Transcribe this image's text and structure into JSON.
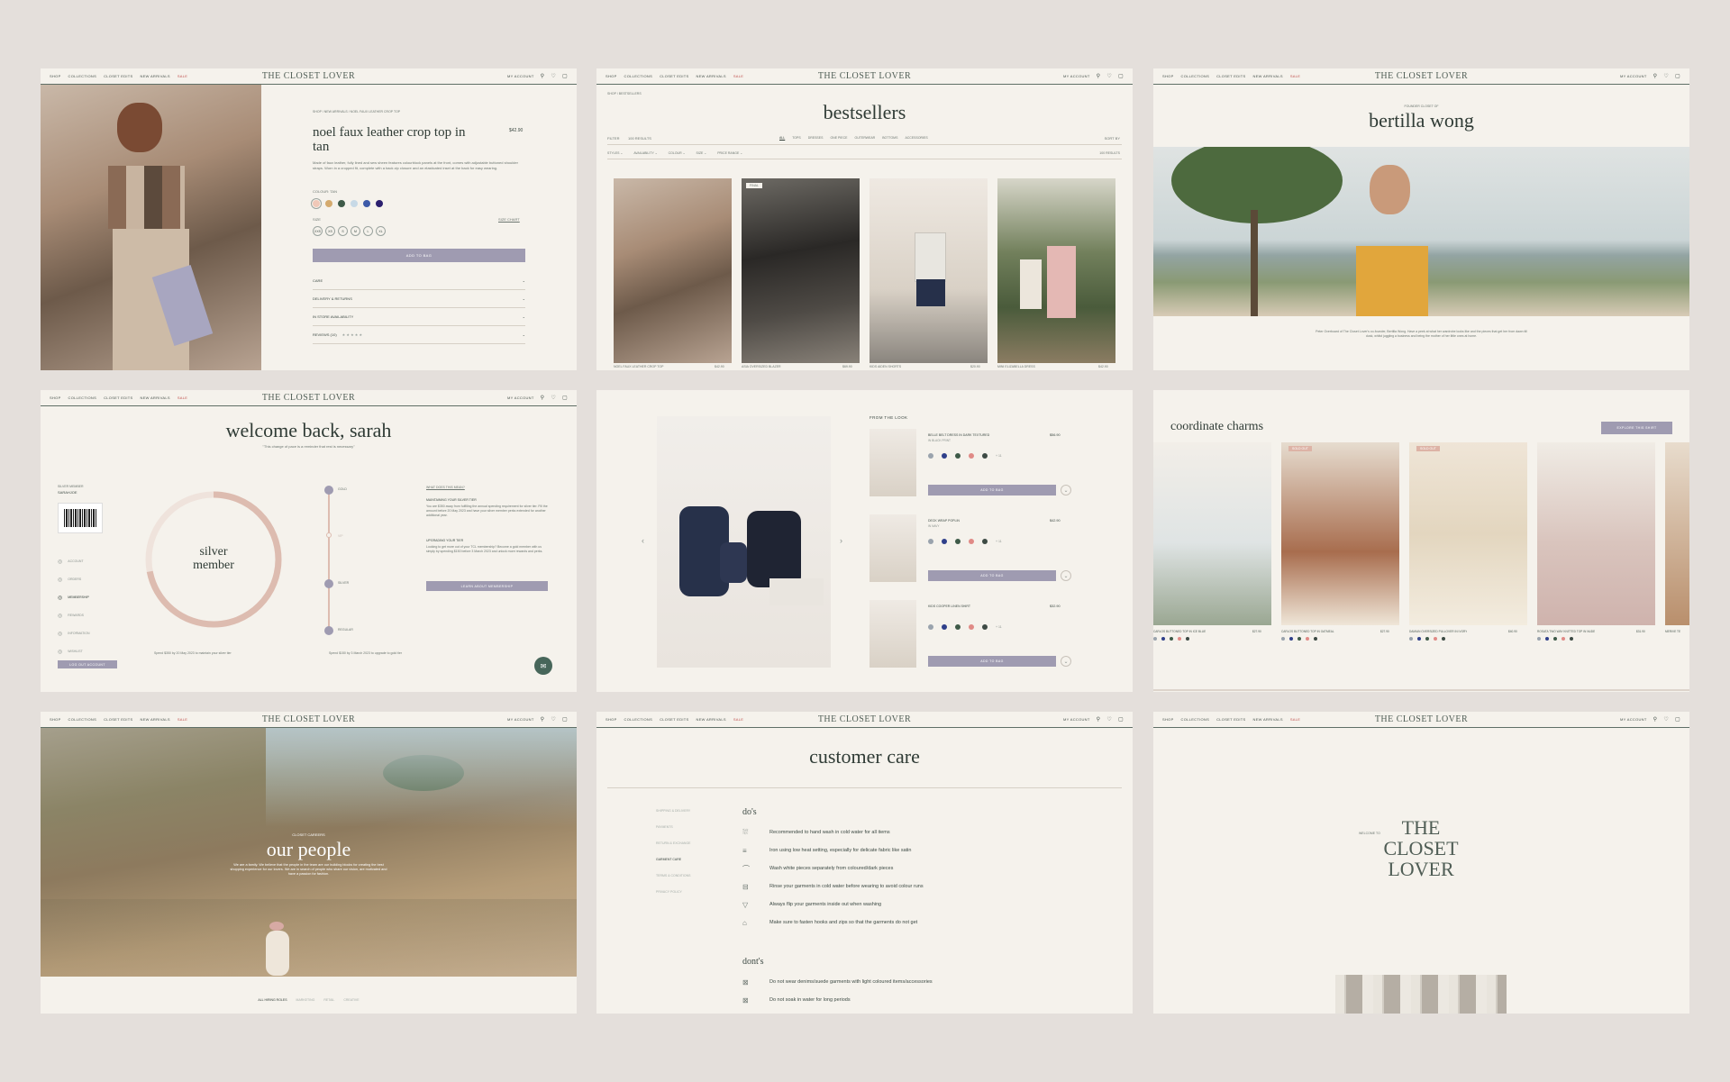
{
  "nav": {
    "links": [
      "SHOP",
      "COLLECTIONS",
      "CLOSET EDITS",
      "NEW ARRIVALS",
      "SALE"
    ],
    "logo": "THE CLOSET LOVER",
    "account": "MY ACCOUNT"
  },
  "product": {
    "breadcrumb": "SHOP / NEW ARRIVALS / NOEL FAUX LEATHER CROP TOP",
    "title": "noel faux leather crop top in tan",
    "price": "$42.90",
    "description": "Made of faux leather, fully lined and sew sheen features colourblock panels at the front, comes with adjustable buttoned shoulder straps. Worn in a cropped fit, complete with a back zip closure and an elasticated inset at the back for easy wearing.",
    "colour_label": "COLOUR: TAN",
    "swatches": [
      "#f0c8b8",
      "#d4aa6e",
      "#3e5a48",
      "#c7d9e6",
      "#3d5aa8",
      "#2b1f6e"
    ],
    "size_label": "SIZE",
    "size_chart": "SIZE CHART",
    "sizes": [
      "XXS",
      "XS",
      "S",
      "M",
      "L",
      "XL"
    ],
    "add_to_bag": "ADD TO BAG",
    "accordions": [
      "CARE",
      "DELIVERY & RETURNS",
      "IN STORE AVAILABILITY",
      "REVIEWS (10)"
    ],
    "stars": "★ ★ ★ ★ ★"
  },
  "bestsellers": {
    "breadcrumb": "SHOP / BESTSELLERS",
    "title": "bestsellers",
    "filters": [
      "FILTER",
      "100 RESULTS"
    ],
    "tabs": [
      "ALL",
      "TOPS",
      "DRESSES",
      "ONE PIECE",
      "OUTERWEAR",
      "BOTTOMS",
      "ACCESSORIES"
    ],
    "sort": "SORT BY",
    "subfilters": [
      "STYLES",
      "AVAILABILITY",
      "COLOUR",
      "SIZE",
      "PRICE RANGE"
    ],
    "results": "100 RESULTS",
    "badge": "FINAL",
    "items": [
      {
        "name": "NOEL FAUX LEATHER CROP TOP",
        "price": "$42.90"
      },
      {
        "name": "ASIA OVERSIZED BLAZER",
        "price": "$69.90"
      },
      {
        "name": "KIDS AIDEN SHORTS",
        "price": "$20.90"
      },
      {
        "name": "MINI ELIZABELLA DRESS",
        "price": "$42.90"
      }
    ]
  },
  "founder": {
    "eyebrow": "FOUNDER CLOSET OF",
    "title": "bertilla wong",
    "caption": "Peter Overboard of The Closet Lover's co-founder, Bertilla Wong. Have a peek at what her wardrobe looks like and the pieces that get her from dawn till dusk, whilst juggling a business and being the mother of her little ones at home."
  },
  "member": {
    "title": "welcome back, sarah",
    "subtitle": "\"This change of pace is a reminder that rest is necessary\"",
    "member_label": "SILVER MEMBER",
    "member_name": "SARAHJOE",
    "menu": [
      "ACCOUNT",
      "ORDERS",
      "MEMBERSHIP",
      "REWARDS",
      "INFORMATION",
      "WISHLIST"
    ],
    "logout": "LOG OUT ACCOUNT",
    "ring_label": "silver member",
    "ring_progress": 0.72,
    "tiers": [
      "GOLD",
      "VIP",
      "SILVER",
      "REGULAR"
    ],
    "note1": "Spend $350 by 20 May 2023 to maintain your silver tier",
    "note2": "Spend $150 by 3 March 2023 to upgrade to gold tier",
    "faq_q": "WHAT DOES THIS MEAN?",
    "faq_h1": "MAINTAINING YOUR SILVER TIER",
    "faq_p1": "You are $350 away from fulfilling the annual spending requirement for silver tier. Fill the amount before 20 May 2023 and have your silver member perks extended for another additional year.",
    "faq_h2": "UPGRADING YOUR TIER",
    "faq_p2": "Looking to get more out of your TCL membership? Become a gold member with us simply by spending $150 before 3 March 2023 and unlock more rewards and perks.",
    "learn": "LEARN ABOUT MEMBERSHIP"
  },
  "look": {
    "title": "FROM THE LOOK",
    "items": [
      {
        "name": "BELLE BELT DRESS IN DARK TEXTURED",
        "sub": "IN BLACK PRINT",
        "price": "$56.90"
      },
      {
        "name": "DECK WRAP POPLIN",
        "sub": "IN NAVY",
        "price": "$42.90"
      },
      {
        "name": "KIDS COOPER LINEN SHIRT",
        "sub": "",
        "price": "$32.90"
      }
    ],
    "add": "ADD TO BAG",
    "more": "+ 11"
  },
  "charms": {
    "title": "coordinate charms",
    "button": "EXPLORE THIS SHIRT",
    "sold_out": "SOLD OUT",
    "items": [
      {
        "name": "CARLOS BUTTONED TOP IN ICE BLUE",
        "price": "$27.90"
      },
      {
        "name": "CARLOS BUTTONED TOP IN OATMEAL",
        "price": "$27.90"
      },
      {
        "name": "DAMIAN OVERSIZED PULLOVER IN IVORY",
        "price": "$40.90"
      },
      {
        "name": "ROSATA TWO WAY KNITTED TOP IN NUDE",
        "price": "$31.90"
      },
      {
        "name": "MERIVE TE",
        "price": ""
      }
    ]
  },
  "careers": {
    "eyebrow": "CLOSET CAREERS",
    "title": "our people",
    "text": "We are a family. We believe that the people in the team are our building blocks for creating the best shopping experience for our lovers. We are in search of people who share our vision, are motivated and have a passion for fashion.",
    "tabs": [
      "ALL HIRING ROLES",
      "MARKETING",
      "RETAIL",
      "CREATIVE"
    ]
  },
  "care": {
    "title": "customer care",
    "menu": [
      "SHIPPING & DELIVERY",
      "PAYMENTS",
      "RETURN & EXCHANGE",
      "GARMENT CARE",
      "TERMS & CONDITIONS",
      "PRIVACY POLICY"
    ],
    "dos_title": "do's",
    "dos": [
      "Recommended to hand wash in cold water for all items",
      "Iron using low heat setting, especially for delicate fabric like satin",
      "Wash white pieces separately from coloured/dark pieces",
      "Rinse your garments in cold water before wearing to avoid colour runs",
      "Always flip your garments inside out when washing",
      "Make sure to fasten hooks and zips so that the garments do not get"
    ],
    "donts_title": "dont's",
    "donts": [
      "Do not wear denims/suede garments with light coloured items/accessories",
      "Do not soak in water for long periods"
    ]
  },
  "welcome": {
    "small": "WELCOME TO",
    "logo": [
      "THE",
      "CLOSET",
      "LOVER"
    ]
  }
}
